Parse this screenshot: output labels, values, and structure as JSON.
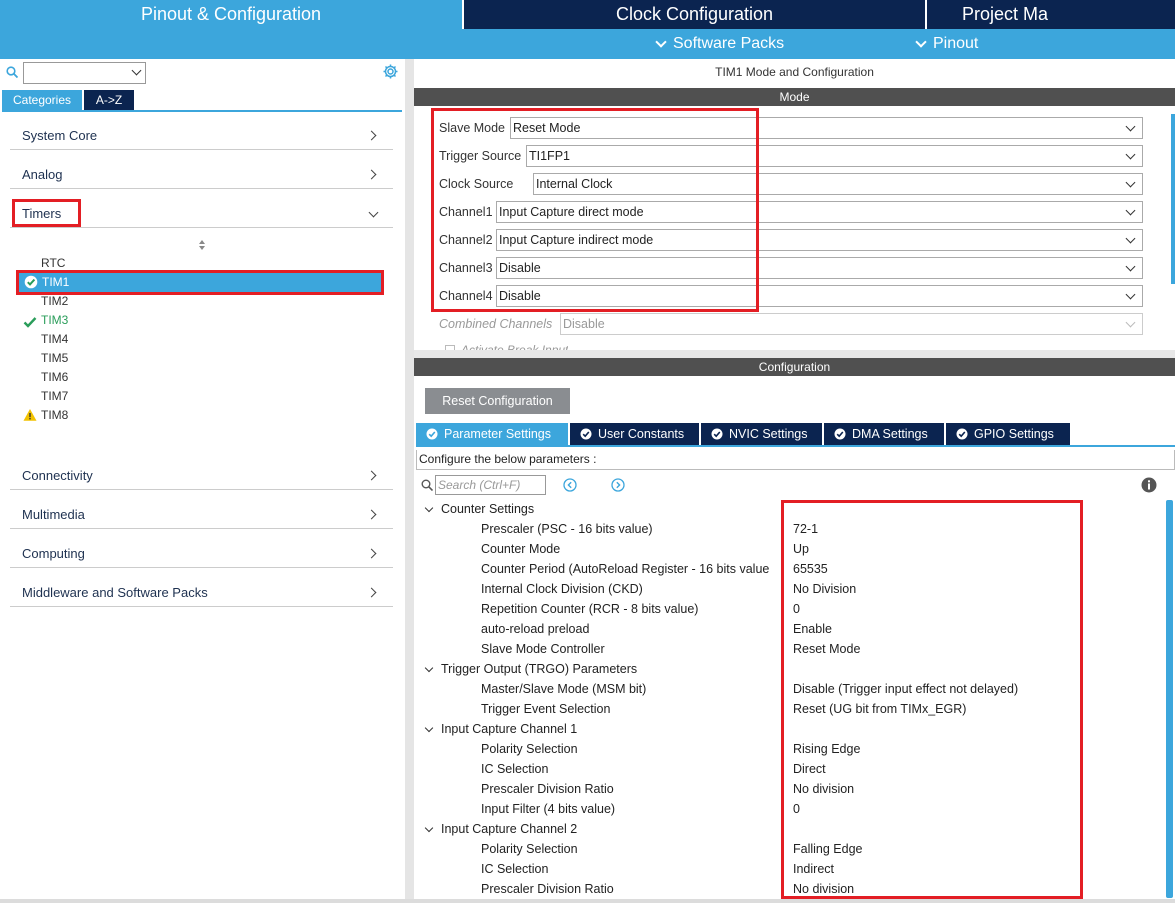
{
  "top_tabs": {
    "pinout": "Pinout & Configuration",
    "clock": "Clock Configuration",
    "project": "Project Ma"
  },
  "subbar": {
    "software_packs": "Software Packs",
    "pinout": "Pinout"
  },
  "left": {
    "search": {
      "value": ""
    },
    "tabs": {
      "categories": "Categories",
      "az": "A->Z"
    },
    "categories": {
      "system_core": "System Core",
      "analog": "Analog",
      "timers": "Timers",
      "connectivity": "Connectivity",
      "multimedia": "Multimedia",
      "computing": "Computing",
      "middleware": "Middleware and Software Packs"
    },
    "timers": [
      "RTC",
      "TIM1",
      "TIM2",
      "TIM3",
      "TIM4",
      "TIM5",
      "TIM6",
      "TIM7",
      "TIM8"
    ]
  },
  "mode": {
    "title": "TIM1 Mode and Configuration",
    "section": "Mode",
    "rows": [
      {
        "label": "Slave Mode",
        "value": "Reset Mode"
      },
      {
        "label": "Trigger Source",
        "value": "TI1FP1"
      },
      {
        "label": "Clock Source",
        "value": "Internal Clock"
      },
      {
        "label": "Channel1",
        "value": "Input Capture direct mode"
      },
      {
        "label": "Channel2",
        "value": "Input Capture indirect mode"
      },
      {
        "label": "Channel3",
        "value": "Disable"
      },
      {
        "label": "Channel4",
        "value": "Disable"
      },
      {
        "label": "Combined Channels",
        "value": "Disable"
      }
    ],
    "cut_text": "Activate Break Input"
  },
  "config": {
    "section": "Configuration",
    "reset_button": "Reset Configuration",
    "tabs": {
      "parameter": "Parameter Settings",
      "user": "User Constants",
      "nvic": "NVIC Settings",
      "dma": "DMA Settings",
      "gpio": "GPIO Settings"
    },
    "configure_text": "Configure the below parameters :",
    "search_placeholder": "Search (Ctrl+F)",
    "groups": {
      "counter": "Counter Settings",
      "trgo": "Trigger Output (TRGO) Parameters",
      "ic1": "Input Capture Channel 1",
      "ic2": "Input Capture Channel 2"
    },
    "params": [
      {
        "label": "Prescaler (PSC - 16 bits value)",
        "value": "72-1"
      },
      {
        "label": "Counter Mode",
        "value": "Up"
      },
      {
        "label": "Counter Period (AutoReload Register - 16 bits value",
        "value": "65535"
      },
      {
        "label": "Internal Clock Division (CKD)",
        "value": "No Division"
      },
      {
        "label": "Repetition Counter (RCR - 8 bits value)",
        "value": "0"
      },
      {
        "label": "auto-reload preload",
        "value": "Enable"
      },
      {
        "label": "Slave Mode Controller",
        "value": "Reset Mode"
      },
      {
        "label": "Master/Slave Mode (MSM bit)",
        "value": "Disable (Trigger input effect not delayed)"
      },
      {
        "label": "Trigger Event Selection",
        "value": "Reset (UG bit from TIMx_EGR)"
      },
      {
        "label": "Polarity Selection",
        "value": "Rising Edge"
      },
      {
        "label": "IC Selection",
        "value": "Direct"
      },
      {
        "label": "Prescaler Division Ratio",
        "value": "No division"
      },
      {
        "label": "Input Filter (4 bits value)",
        "value": "0"
      },
      {
        "label": "Polarity Selection",
        "value": "Falling Edge"
      },
      {
        "label": "IC Selection",
        "value": "Indirect"
      },
      {
        "label": "Prescaler Division Ratio",
        "value": "No division"
      }
    ]
  },
  "colors": {
    "accent": "#3ca6dc",
    "dark_navy": "#0b2450",
    "highlight_red": "#e31e24",
    "ok_green": "#2a9d5a",
    "warn_yellow": "#f2c200"
  }
}
